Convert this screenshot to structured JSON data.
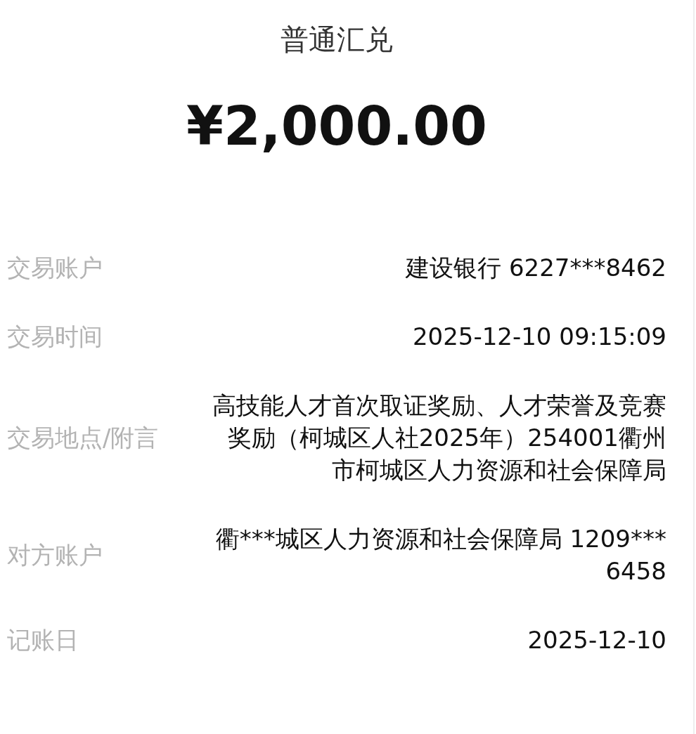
{
  "header": {
    "title": "普通汇兑",
    "amount": "¥2,000.00"
  },
  "details": [
    {
      "label": "交易账户",
      "value": "建设银行 6227***8462"
    },
    {
      "label": "交易时间",
      "value": "2025-12-10 09:15:09"
    },
    {
      "label": "交易地点/附言",
      "value": "高技能人才首次取证奖励、人才荣誉及竞赛奖励（柯城区人社2025年）254001衢州市柯城区人力资源和社会保障局"
    },
    {
      "label": "对方账户",
      "value": "衢***城区人力资源和社会保障局 1209***6458"
    },
    {
      "label": "记账日",
      "value": "2025-12-10"
    }
  ]
}
